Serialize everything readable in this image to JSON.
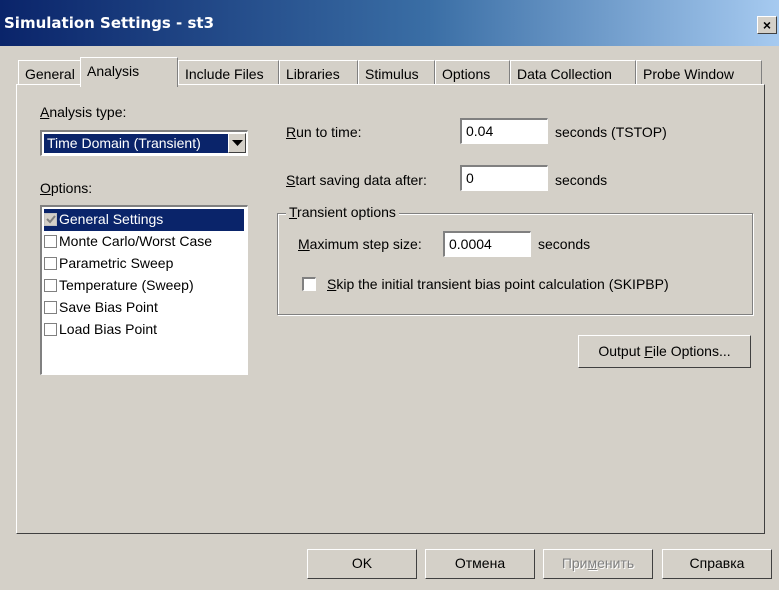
{
  "window": {
    "title": "Simulation Settings - st3",
    "close_glyph": "×"
  },
  "tabs": [
    {
      "label": "General"
    },
    {
      "label": "Analysis"
    },
    {
      "label": "Include Files"
    },
    {
      "label": "Libraries"
    },
    {
      "label": "Stimulus"
    },
    {
      "label": "Options"
    },
    {
      "label": "Data Collection"
    },
    {
      "label": "Probe Window"
    }
  ],
  "analysis": {
    "type_label_pre": "",
    "type_label_u": "A",
    "type_label_post": "nalysis type:",
    "type_value": "Time Domain (Transient)",
    "options_label_u": "O",
    "options_label_post": "ptions:",
    "options": [
      {
        "label": "General Settings",
        "checked": true,
        "selected": true
      },
      {
        "label": "Monte Carlo/Worst Case",
        "checked": false,
        "selected": false
      },
      {
        "label": "Parametric Sweep",
        "checked": false,
        "selected": false
      },
      {
        "label": "Temperature (Sweep)",
        "checked": false,
        "selected": false
      },
      {
        "label": "Save Bias Point",
        "checked": false,
        "selected": false
      },
      {
        "label": "Load Bias Point",
        "checked": false,
        "selected": false
      }
    ]
  },
  "run_to": {
    "label_u": "R",
    "label_post": "un to time:",
    "value": "0.04",
    "unit": "seconds  (TSTOP)"
  },
  "start_saving": {
    "label_u": "S",
    "label_post": "tart saving data after:",
    "value": "0",
    "unit": "seconds"
  },
  "transient": {
    "title_u": "T",
    "title_post": "ransient options",
    "max_step_label_u": "M",
    "max_step_label_post": "aximum step size:",
    "max_step_value": "0.0004",
    "max_step_unit": "seconds",
    "skip_label_u": "S",
    "skip_label_post": "kip the initial transient bias point calculation  (SKIPBP)",
    "skip_checked": false
  },
  "output_file": {
    "pre": "Output ",
    "u": "F",
    "post": "ile Options..."
  },
  "buttons": {
    "ok": "OK",
    "cancel": "Отмена",
    "apply_pre": "При",
    "apply_u": "м",
    "apply_post": "енить",
    "help": "Справка"
  }
}
